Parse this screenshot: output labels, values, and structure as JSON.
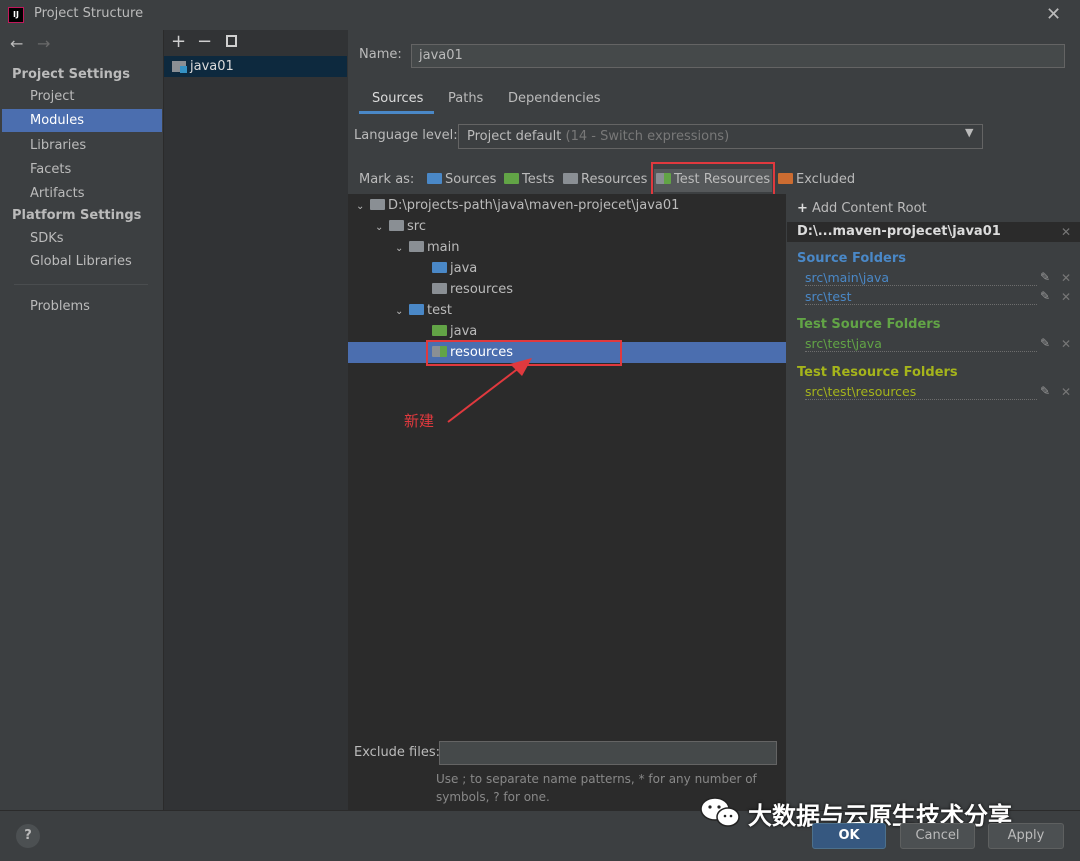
{
  "window": {
    "title": "Project Structure",
    "icon_text": "IJ"
  },
  "nav": {
    "project_settings_heading": "Project Settings",
    "platform_settings_heading": "Platform Settings",
    "items": {
      "project": "Project",
      "modules": "Modules",
      "libraries": "Libraries",
      "facets": "Facets",
      "artifacts": "Artifacts",
      "sdks": "SDKs",
      "global_libraries": "Global Libraries",
      "problems": "Problems"
    },
    "selected": "Modules"
  },
  "modules": {
    "list": [
      "java01"
    ],
    "selected": "java01"
  },
  "editor": {
    "name_label": "Name:",
    "name_value": "java01",
    "tabs": [
      "Sources",
      "Paths",
      "Dependencies"
    ],
    "active_tab": "Sources",
    "language_label": "Language level:",
    "language_value": "Project default",
    "language_hint": "(14 - Switch expressions)",
    "mark_as_label": "Mark as:",
    "mark_as": [
      "Sources",
      "Tests",
      "Resources",
      "Test Resources",
      "Excluded"
    ],
    "tree": {
      "root": "D:\\projects-path\\java\\maven-projecet\\java01",
      "src": "src",
      "main": "main",
      "main_java": "java",
      "main_resources": "resources",
      "test": "test",
      "test_java": "java",
      "test_resources": "resources"
    },
    "selected_node": "resources",
    "annotation": "新建",
    "exclude_label": "Exclude files:",
    "exclude_value": "",
    "exclude_hint": "Use ; to separate name patterns, * for any number of symbols, ? for one."
  },
  "roots": {
    "add_label": "Add Content Root",
    "root_path": "D:\\...maven-projecet\\java01",
    "source_heading": "Source Folders",
    "source_folders": [
      "src\\main\\java",
      "src\\test"
    ],
    "test_source_heading": "Test Source Folders",
    "test_source_folders": [
      "src\\test\\java"
    ],
    "test_resource_heading": "Test Resource Folders",
    "test_resource_folders": [
      "src\\test\\resources"
    ]
  },
  "buttons": {
    "help": "?",
    "ok": "OK",
    "cancel": "Cancel",
    "apply": "Apply"
  },
  "watermark": "大数据与云原生技术分享",
  "colors": {
    "source": "#4a88c7",
    "test": "#62a446",
    "resource": "#8a8f94",
    "excluded": "#cc6c31",
    "test_resource_heading": "#a5b41b",
    "selection": "#4b6eaf",
    "annotation": "#e0393e"
  }
}
